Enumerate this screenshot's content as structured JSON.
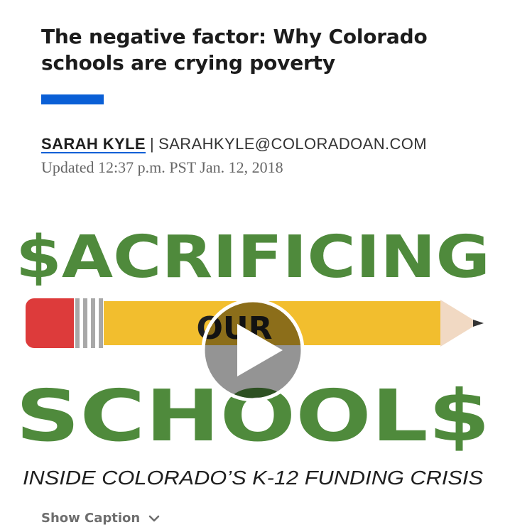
{
  "article": {
    "headline": "The negative factor: Why Colorado schools are crying poverty",
    "author": "SARAH KYLE",
    "separator": "|",
    "email": "SARAHKYLE@COLORADOAN.COM",
    "updated": "Updated 12:37 p.m. PST Jan. 12, 2018"
  },
  "graphic": {
    "line1": "$ACRIFICING",
    "line2": "OUR",
    "line3": "SCHOOL$",
    "subtitle": "INSIDE COLORADO’S K-12 FUNDING CRISIS",
    "colors": {
      "green": "#4f8a3c",
      "pencil_yellow": "#f2be2e",
      "eraser_red": "#dd3b3b",
      "band_gray": "#a8a8a8",
      "wood": "#f1d9c3",
      "lead": "#333333"
    },
    "play_icon": "play-icon"
  },
  "caption_toggle": {
    "label": "Show Caption",
    "icon": "chevron-down-icon"
  },
  "colors": {
    "accent": "#0a5fd6",
    "headline_text": "#1c1c1c",
    "meta_text": "#666666"
  }
}
